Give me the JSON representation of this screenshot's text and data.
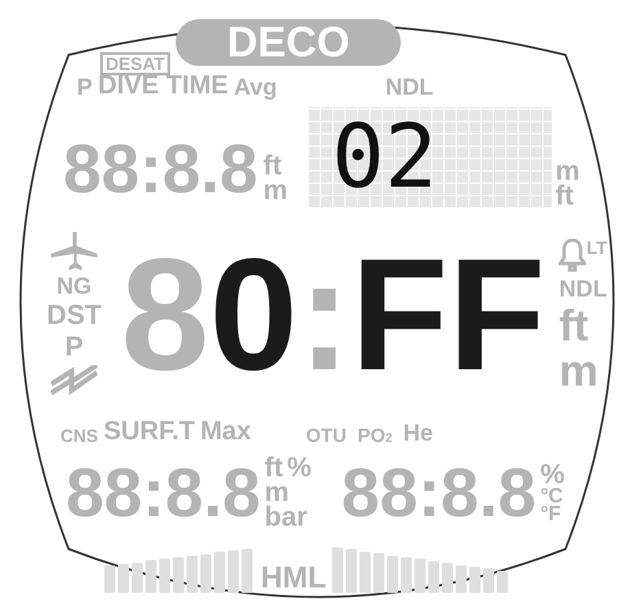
{
  "top": {
    "desat": {
      "text": "DESAT",
      "lit": false
    },
    "deco": {
      "text": "DECO",
      "lit": false
    }
  },
  "upper_left": {
    "labels": [
      {
        "text": "P",
        "lit": false
      },
      {
        "text": "DIVE TIME",
        "lit": false
      },
      {
        "text": "Avg",
        "lit": false
      }
    ],
    "readout": {
      "text": "88:8.8",
      "lit": false
    },
    "units": [
      {
        "text": "ft",
        "lit": false
      },
      {
        "text": "m",
        "lit": false
      }
    ]
  },
  "upper_right": {
    "label": {
      "text": "NDL",
      "lit": false
    },
    "matrix": {
      "text": "02"
    },
    "units": [
      {
        "text": "m",
        "lit": false
      },
      {
        "text": "ft",
        "lit": false
      }
    ]
  },
  "left_indicators": [
    {
      "text": "NG",
      "lit": false
    },
    {
      "text": "DST",
      "lit": false
    },
    {
      "text": "P",
      "lit": false
    }
  ],
  "main_readout": {
    "chars": [
      {
        "text": "8",
        "lit": false
      },
      {
        "text": "0",
        "lit": true
      },
      {
        "text": ":",
        "lit": false
      },
      {
        "text": "F",
        "lit": true
      },
      {
        "text": "F",
        "lit": true
      }
    ]
  },
  "right_indicators": [
    {
      "text": "LT",
      "lit": false
    },
    {
      "text": "NDL",
      "lit": false
    },
    {
      "text": "ft",
      "lit": false
    },
    {
      "text": "m",
      "lit": false
    }
  ],
  "bottom_left": {
    "labels": [
      {
        "text": "CNS",
        "lit": false
      },
      {
        "text": "SURF.T",
        "lit": false
      },
      {
        "text": "Max",
        "lit": false
      }
    ],
    "readout": {
      "text": "88:8.8",
      "lit": false
    },
    "units": [
      {
        "text": "ft",
        "lit": false
      },
      {
        "text": "%",
        "lit": false
      },
      {
        "text": "m",
        "lit": false
      },
      {
        "text": "bar",
        "lit": false
      }
    ]
  },
  "bottom_right": {
    "labels": [
      {
        "text": "OTU",
        "lit": false
      },
      {
        "text": "PO$_{2}$",
        "lit": false
      },
      {
        "text": "He",
        "lit": false
      }
    ],
    "readout": {
      "text": "88:8.8",
      "lit": false
    },
    "units": [
      {
        "text": "%",
        "lit": false
      },
      {
        "text": "°C",
        "lit": false
      },
      {
        "text": "°F",
        "lit": false
      }
    ]
  },
  "hml": {
    "text": "HML",
    "lit": false
  }
}
